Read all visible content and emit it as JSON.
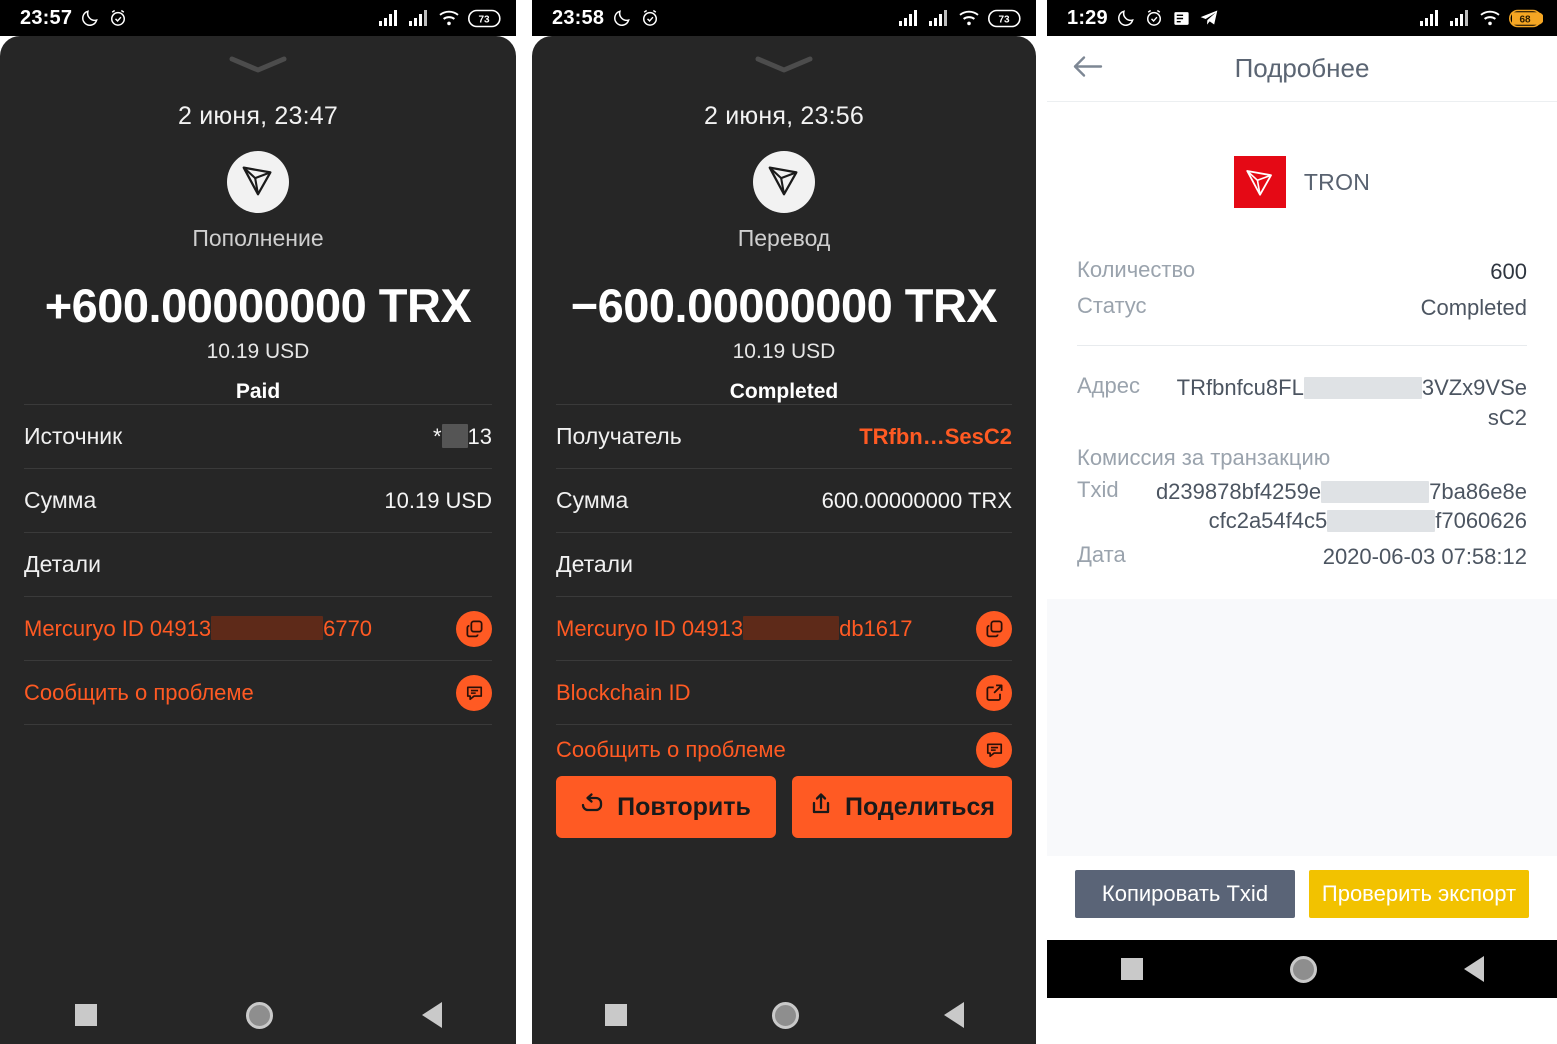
{
  "panel1": {
    "status_bar": {
      "clock": "23:57",
      "icons_left": [
        "moon-icon",
        "alarm-icon"
      ],
      "icons_right": [
        "signal-icon",
        "signal-icon",
        "wifi-icon",
        "battery-icon"
      ],
      "battery_level": "73"
    },
    "grabber": "chevron-down-handle",
    "date": "2 июня, 23:47",
    "coin_icon": "tron-logo-icon",
    "kind": "Пополнение",
    "amount": "+600.00000000 TRX",
    "fiat": "10.19 USD",
    "status": "Paid",
    "rows": [
      {
        "label": "Источник",
        "value_prefix": "*",
        "value_suffix": "13"
      },
      {
        "label": "Сумма",
        "value": "10.19 USD"
      },
      {
        "label": "Детали",
        "value": ""
      }
    ],
    "links": [
      {
        "text_prefix": "Mercuryo ID 04913",
        "text_suffix": "6770",
        "icon": "copy-icon"
      },
      {
        "text": "Сообщить о проблеме",
        "icon": "chat-icon"
      }
    ],
    "navbar": [
      "recents-square-icon",
      "home-circle-icon",
      "back-triangle-icon"
    ]
  },
  "panel2": {
    "status_bar": {
      "clock": "23:58",
      "battery_level": "73"
    },
    "date": "2 июня, 23:56",
    "coin_icon": "tron-logo-icon",
    "kind": "Перевод",
    "amount": "−600.00000000 TRX",
    "fiat": "10.19 USD",
    "status": "Completed",
    "rows": [
      {
        "label": "Получатель",
        "value": "TRfbn…SesC2",
        "accent": true
      },
      {
        "label": "Сумма",
        "value": "600.00000000 TRX"
      },
      {
        "label": "Детали",
        "value": ""
      }
    ],
    "links": [
      {
        "text_prefix": "Mercuryo ID 04913",
        "text_suffix": "db1617",
        "icon": "copy-icon"
      },
      {
        "text": "Blockchain ID",
        "icon": "external-link-icon"
      },
      {
        "text": "Сообщить о проблеме",
        "icon": "chat-icon"
      }
    ],
    "buttons": [
      {
        "label": "Повторить",
        "icon": "repeat-icon"
      },
      {
        "label": "Поделиться",
        "icon": "share-icon"
      }
    ],
    "navbar": [
      "recents-square-icon",
      "home-circle-icon",
      "back-triangle-icon"
    ]
  },
  "panel3": {
    "status_bar": {
      "clock": "1:29",
      "icons_left": [
        "moon-icon",
        "alarm-icon",
        "news-icon",
        "telegram-icon"
      ],
      "battery_level": "68"
    },
    "header": {
      "back_icon": "arrow-left-icon",
      "title": "Подробнее"
    },
    "coin": {
      "icon": "tron-logo-icon",
      "name": "TRON"
    },
    "summary": [
      {
        "key": "Количество",
        "value": "600"
      },
      {
        "key": "Статус",
        "value": "Completed"
      }
    ],
    "details": [
      {
        "key": "Адрес",
        "value_prefix": "TRfbnfcu8FL",
        "value_suffix": "3VZx9VSe",
        "value_line2": "sC2"
      },
      {
        "key": "Комиссия за транзакцию",
        "value": ""
      },
      {
        "key": "Txid",
        "value_prefix": "d239878bf4259e",
        "value_suffix": "7ba86e8e",
        "value_prefix2": "cfc2a54f4c5",
        "value_suffix2": "f7060626"
      },
      {
        "key": "Дата",
        "value": "2020-06-03 07:58:12"
      }
    ],
    "buttons": [
      {
        "label": "Копировать Txid",
        "style": "grey"
      },
      {
        "label": "Проверить экспорт",
        "style": "yellow"
      }
    ],
    "navbar": [
      "recents-square-icon",
      "home-circle-icon",
      "back-triangle-icon"
    ]
  },
  "colors": {
    "accent_orange": "#ff5a23",
    "dark_bg": "#262626",
    "tron_red": "#e50915",
    "button_grey": "#5a6477",
    "button_yellow": "#f2c200",
    "battery_orange": "#f5a623"
  }
}
